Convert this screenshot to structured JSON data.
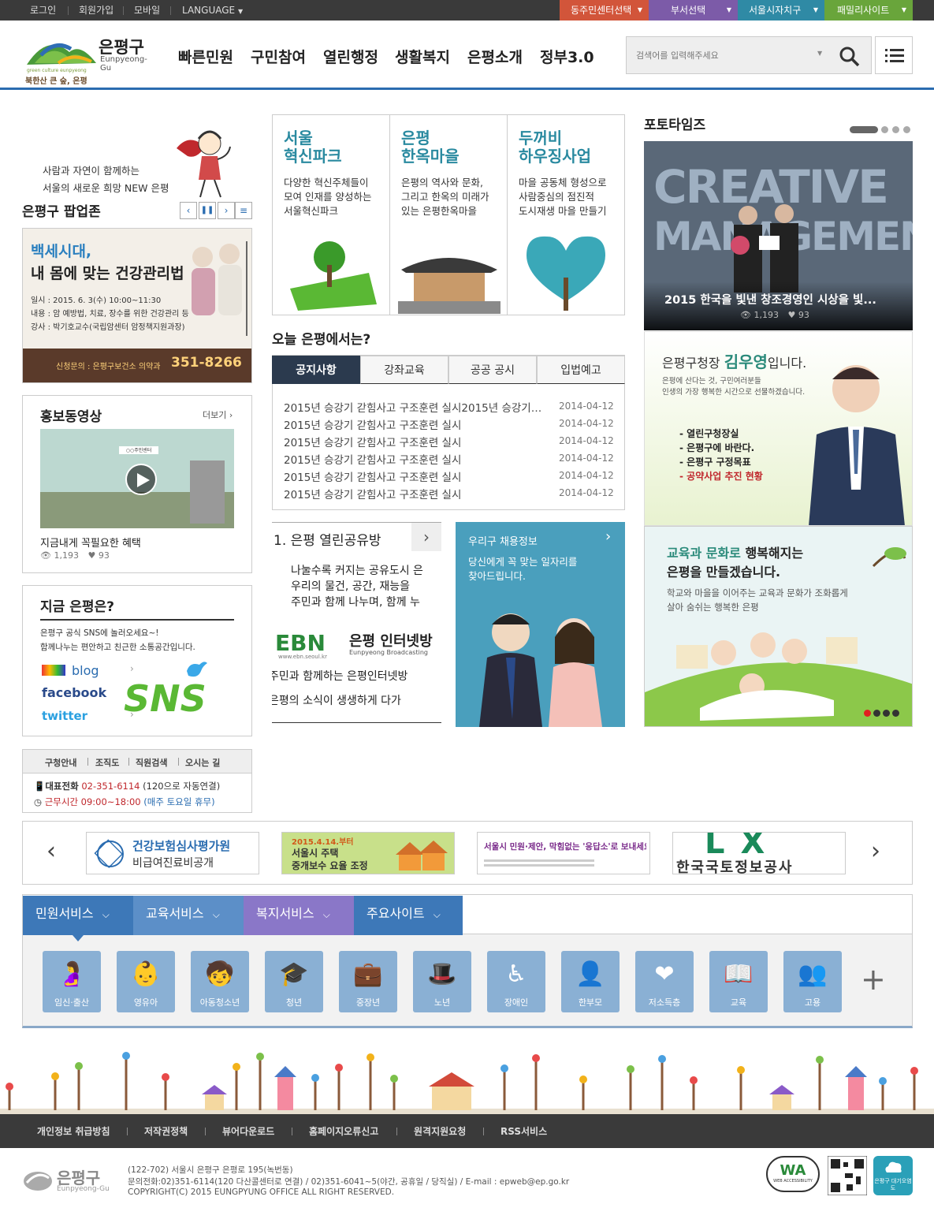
{
  "topbar": {
    "links": [
      "로그인",
      "회원가입",
      "모바일",
      "LANGUAGE"
    ],
    "tabs": [
      {
        "label": "동주민센터선택",
        "color": "#d2553a"
      },
      {
        "label": "부서선택",
        "color": "#7c5ba8"
      },
      {
        "label": "서울시자치구",
        "color": "#2f8aa5"
      },
      {
        "label": "패밀리사이트",
        "color": "#69a53b"
      }
    ]
  },
  "logo": {
    "name": "은평구",
    "eng": "Eunpyeong-Gu",
    "slogan": "북한산 큰 숲, 은평",
    "small": "green culture eunpyeong"
  },
  "nav": [
    "빠른민원",
    "구민참여",
    "열린행정",
    "생활복지",
    "은평소개",
    "정부3.0"
  ],
  "search": {
    "placeholder": "검색어를 입력해주세요"
  },
  "popup": {
    "tagline1": "사람과 자연이 함께하는",
    "tagline2": "서울의 새로운 희망 NEW 은평",
    "title": "은평구 팝업존",
    "banner_title1": "백세시대,",
    "banner_title2": "내 몸에 맞는 건강관리법",
    "line1": "일시 : 2015. 6. 3(수) 10:00~11:30",
    "line2": "내용 : 암 예방법, 치료, 장수를 위한 건강관리 등",
    "line3": "강사 : 박기호교수(국립암센터 암정책지원과장)",
    "inquiry": "신청문의 : 은평구보건소 의약과",
    "phone": "351-8266"
  },
  "video": {
    "title": "홍보동영상",
    "more": "더보기",
    "caption": "지금내게 꼭필요한 혜택",
    "views": "1,193",
    "likes": "93",
    "sign": "○○주민센터"
  },
  "now": {
    "title": "지금 은평은?",
    "desc1": "은평구 공식 SNS에 놀러오세요~!",
    "desc2": "함께나누는 편안하고 친근한 소통공간입니다.",
    "blog": "blog",
    "facebook": "facebook",
    "twitter": "twitter",
    "sns": "SNS"
  },
  "info": {
    "links": [
      "구청안내",
      "조직도",
      "직원검색",
      "오시는 길"
    ],
    "phone_label": "대표전화",
    "phone": "02-351-6114",
    "phone_note": "(120으로 자동연결)",
    "hours_label": "근무시간 09:00~18:00",
    "hours_note": "(매주 토요일 휴무)"
  },
  "tiles": [
    {
      "title1": "서울",
      "title2": "혁신파크",
      "desc": [
        "다양한 혁신주체들이",
        "모여 인재를 양성하는",
        "서울혁신파크"
      ]
    },
    {
      "title1": "은평",
      "title2": "한옥마을",
      "desc": [
        "은평의 역사와 문화,",
        "그리고 한옥의 미래가",
        "있는 은평한옥마을"
      ]
    },
    {
      "title1": "두꺼비",
      "title2": "하우징사업",
      "desc": [
        "마을 공동체 형성으로",
        "사람중심의 점진적",
        "도시재생 마을 만들기"
      ]
    }
  ],
  "today": {
    "title": "오늘 은평에서는?",
    "tabs": [
      "공지사항",
      "강좌교육",
      "공공 공시",
      "입법예고"
    ],
    "items": [
      {
        "text": "2015년 승강기 갇힘사고 구조훈련 실시2015년 승강기 갇힘사고",
        "date": "2014-04-12"
      },
      {
        "text": "2015년 승강기 갇힘사고 구조훈련 실시",
        "date": "2014-04-12"
      },
      {
        "text": "2015년 승강기 갇힘사고 구조훈련 실시",
        "date": "2014-04-12"
      },
      {
        "text": "2015년 승강기 갇힘사고 구조훈련 실시",
        "date": "2014-04-12"
      },
      {
        "text": "2015년 승강기 갇힘사고 구조훈련 실시",
        "date": "2014-04-12"
      },
      {
        "text": "2015년 승강기 갇힘사고 구조훈련 실시",
        "date": "2014-04-12"
      }
    ]
  },
  "share": {
    "title": "1. 은평 열린공유방",
    "desc1": "나눌수록 커지는 공유도시 은",
    "desc2": "우리의 물건, 공간, 재능을",
    "desc3": "주민과 함께 나누며, 함께 누",
    "ebn": "EBN",
    "ebn_url": "www.ebn.seoul.kr",
    "ebn_title": "은평 인터넷방",
    "ebn_sub": "Eunpyeong Broadcasting",
    "line1": "주민과 함께하는 은평인터넷방",
    "line2": "은평의 소식이 생생하게 다가"
  },
  "jobs": {
    "title": "우리구 채용정보",
    "desc1": "당신에게 꼭 맞는 일자리를",
    "desc2": "찾아드립니다."
  },
  "photo": {
    "title": "포토타임즈",
    "caption": "2015 한국을 빛낸 창조경영인 시상을 빛...",
    "views": "1,193",
    "likes": "93",
    "bg_text1": "CREATIVE",
    "bg_text2": "MANAGEMENT"
  },
  "mayor": {
    "prefix": "은평구청장",
    "name": "김우영",
    "suffix": "입니다.",
    "desc1": "은평에 산다는 것, 구민여러분들",
    "desc2": "인생의 가장 행복한 시간으로 선물하겠습니다.",
    "links": [
      "- 열린구청장실",
      "- 은평구에 바란다.",
      "- 은평구 구정목표",
      "- 공약사업 추진 현황"
    ]
  },
  "edu": {
    "title1a": "교육과 문화로",
    "title1b": " 행복해지는",
    "title2": "은평을 만들겠습니다.",
    "desc1": "학교와 마을을 이어주는 교육과 문화가 조화롭게",
    "desc2": "살아 숨쉬는 행복한 은평"
  },
  "banners": {
    "hira1": "건강보험심사평가원",
    "hira2": "비급여진료비공개",
    "seoul_date": "2015.4.14.부터",
    "seoul1": "서울시 주택",
    "seoul2": "중개보수 요율 조정",
    "ung": "서울시 민원·제안, 막힘없는 '응답소'로 보내세요!",
    "lx_logo": "LX",
    "lx": "한국국토정보공사"
  },
  "services": {
    "tabs": [
      {
        "label": "민원서비스",
        "color": "#3d78b8"
      },
      {
        "label": "교육서비스",
        "color": "#5c8fc8"
      },
      {
        "label": "복지서비스",
        "color": "#8a77c8"
      },
      {
        "label": "주요사이트",
        "color": "#3d78b8"
      }
    ],
    "items": [
      {
        "label": "임신·출산",
        "icon": "pregnant-icon",
        "glyph": "🤰"
      },
      {
        "label": "영유아",
        "icon": "baby-icon",
        "glyph": "👶"
      },
      {
        "label": "아동청소년",
        "icon": "child-icon",
        "glyph": "🧒"
      },
      {
        "label": "청년",
        "icon": "graduation-cap-icon",
        "glyph": "🎓"
      },
      {
        "label": "중장년",
        "icon": "briefcase-icon",
        "glyph": "💼"
      },
      {
        "label": "노년",
        "icon": "elder-icon",
        "glyph": "🎩"
      },
      {
        "label": "장애인",
        "icon": "wheelchair-icon",
        "glyph": "♿"
      },
      {
        "label": "한부모",
        "icon": "parent-icon",
        "glyph": "👤"
      },
      {
        "label": "저소득층",
        "icon": "heart-hand-icon",
        "glyph": "❤"
      },
      {
        "label": "교육",
        "icon": "book-icon",
        "glyph": "📖"
      },
      {
        "label": "고용",
        "icon": "group-icon",
        "glyph": "👥"
      }
    ]
  },
  "footer": {
    "links": [
      "개인정보 취급방침",
      "저작권정책",
      "뷰어다운로드",
      "홈페이지오류신고",
      "원격지원요청",
      "RSS서비스"
    ],
    "logo": "은평구",
    "logo_eng": "Eunpyeong-Gu",
    "address": "(122-702) 서울시 은평구 은평로 195(녹번동)",
    "contact": "문의전화:02)351-6114(120 다산콜센터로 연결) / 02)351-6041~5(야간, 공휴일 / 당직실) / E-mail : epweb@ep.go.kr",
    "copyright": "COPYRIGHT(C) 2015 EUNGPYUNG OFFICE ALL RIGHT RESERVED.",
    "wa": "WA",
    "wa_sub": "WEB ACCESSIBILITY",
    "air": "은평구 대기오염도"
  }
}
